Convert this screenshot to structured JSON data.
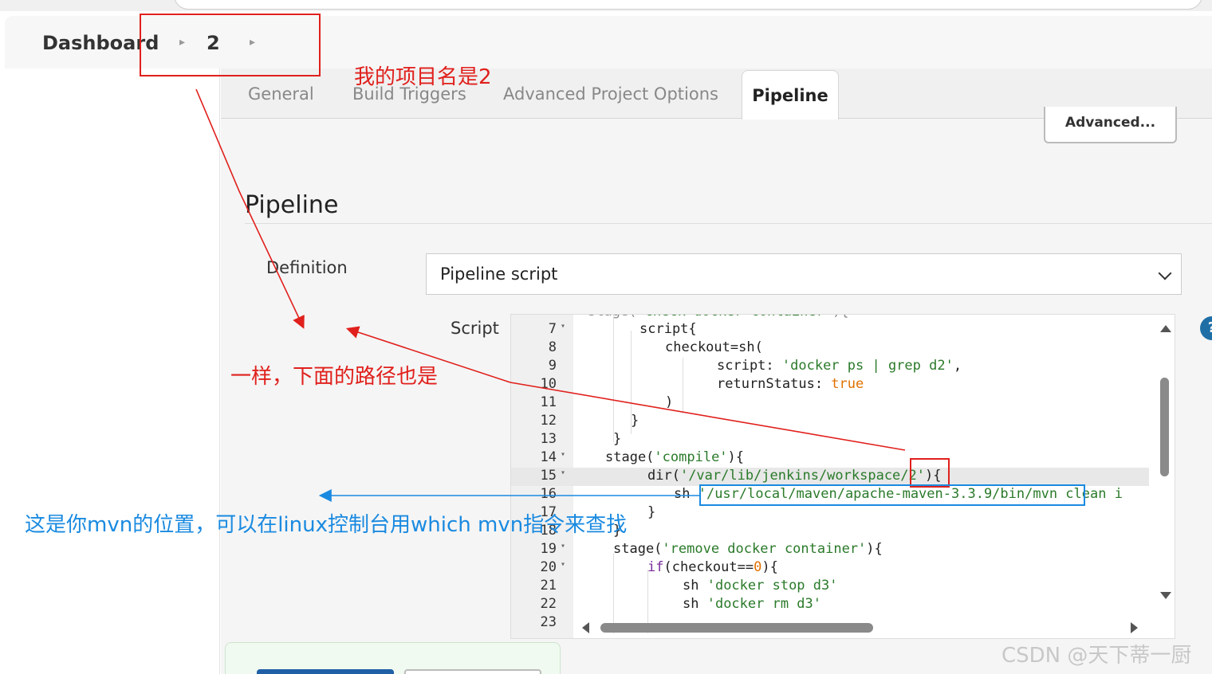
{
  "breadcrumb": {
    "dashboard": "Dashboard",
    "project": "2"
  },
  "tabs": {
    "general": "General",
    "build_triggers": "Build Triggers",
    "advanced_project_options": "Advanced Project Options",
    "pipeline": "Pipeline"
  },
  "advanced_button": "Advanced...",
  "section": {
    "title": "Pipeline",
    "definition_label": "Definition",
    "definition_value": "Pipeline script",
    "script_label": "Script"
  },
  "editor": {
    "lines": [
      {
        "n": "7",
        "fold": true
      },
      {
        "n": "8",
        "fold": false
      },
      {
        "n": "9",
        "fold": false
      },
      {
        "n": "10",
        "fold": false
      },
      {
        "n": "11",
        "fold": false
      },
      {
        "n": "12",
        "fold": false
      },
      {
        "n": "13",
        "fold": false
      },
      {
        "n": "14",
        "fold": true
      },
      {
        "n": "15",
        "fold": true
      },
      {
        "n": "16",
        "fold": false
      },
      {
        "n": "17",
        "fold": false
      },
      {
        "n": "18",
        "fold": false
      },
      {
        "n": "19",
        "fold": true
      },
      {
        "n": "20",
        "fold": true
      },
      {
        "n": "21",
        "fold": false
      },
      {
        "n": "22",
        "fold": false
      },
      {
        "n": "23",
        "fold": false
      }
    ],
    "code": {
      "l7": "script{",
      "l8": "checkout=sh(",
      "l9_key": "script: ",
      "l9_str": "'docker ps | grep d2'",
      "l9_end": ",",
      "l10_key": "returnStatus: ",
      "l10_val": "true",
      "l11": ")",
      "l12": "}",
      "l13": "}",
      "l14_a": "stage(",
      "l14_str": "'compile'",
      "l14_b": "){",
      "l15_a": "dir(",
      "l15_str": "'/var/lib/jenkins/workspace/2'",
      "l15_b": "){",
      "l16_a": "sh ",
      "l16_str": "'/usr/local/maven/apache-maven-3.3.9/bin/mvn",
      "l16_b": " clean i",
      "l17": "}",
      "l18": "}",
      "l19_a": "stage(",
      "l19_str": "'remove docker container'",
      "l19_b": "){",
      "l20_kw": "if",
      "l20_a": "(checkout==",
      "l20_num": "0",
      "l20_b": "){",
      "l21_a": "sh ",
      "l21_str": "'docker stop d3'",
      "l22_a": "sh ",
      "l22_str": "'docker rm d3'"
    }
  },
  "annotations": {
    "project_name_note": "我的项目名是2",
    "same_path_note": "一样，下面的路径也是",
    "mvn_note": "这是你mvn的位置，可以在linux控制台用which mvn指令来查找"
  },
  "watermark": "CSDN @天下蒂一厨",
  "colors": {
    "annotation_red": "#e0201c",
    "annotation_blue": "#1a8ae0",
    "primary_button": "#1f5fa6"
  }
}
